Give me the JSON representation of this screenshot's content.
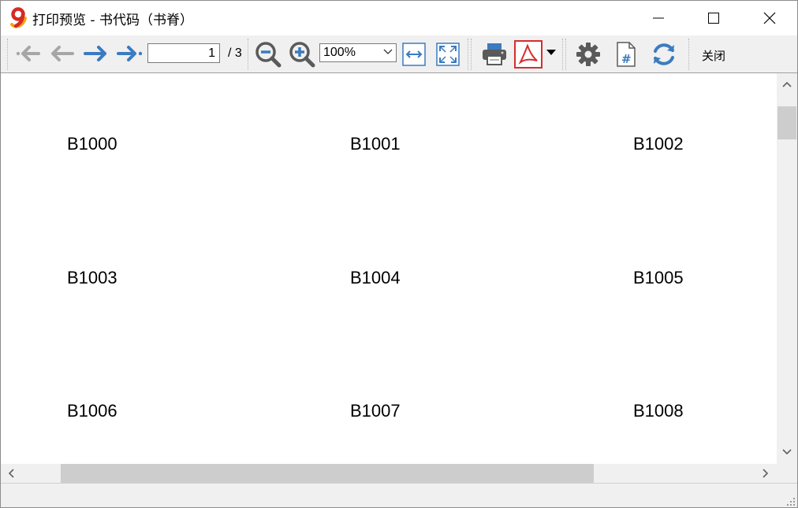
{
  "window": {
    "title": "打印预览 - 书代码（书脊）",
    "logo_icon": "app-logo-nine"
  },
  "toolbar": {
    "first_page_icon": "first-page-arrow-icon",
    "prev_page_icon": "prev-page-arrow-icon",
    "next_page_icon": "next-page-arrow-icon",
    "last_page_icon": "last-page-arrow-icon",
    "page_current": "1",
    "page_total": "/ 3",
    "zoom_value": "100%",
    "close_label": "关闭",
    "accent_color": "#3b7bbf",
    "pdf_color": "#d32f2f"
  },
  "labels": [
    "B1000",
    "B1001",
    "B1002",
    "B1003",
    "B1004",
    "B1005",
    "B1006",
    "B1007",
    "B1008"
  ]
}
